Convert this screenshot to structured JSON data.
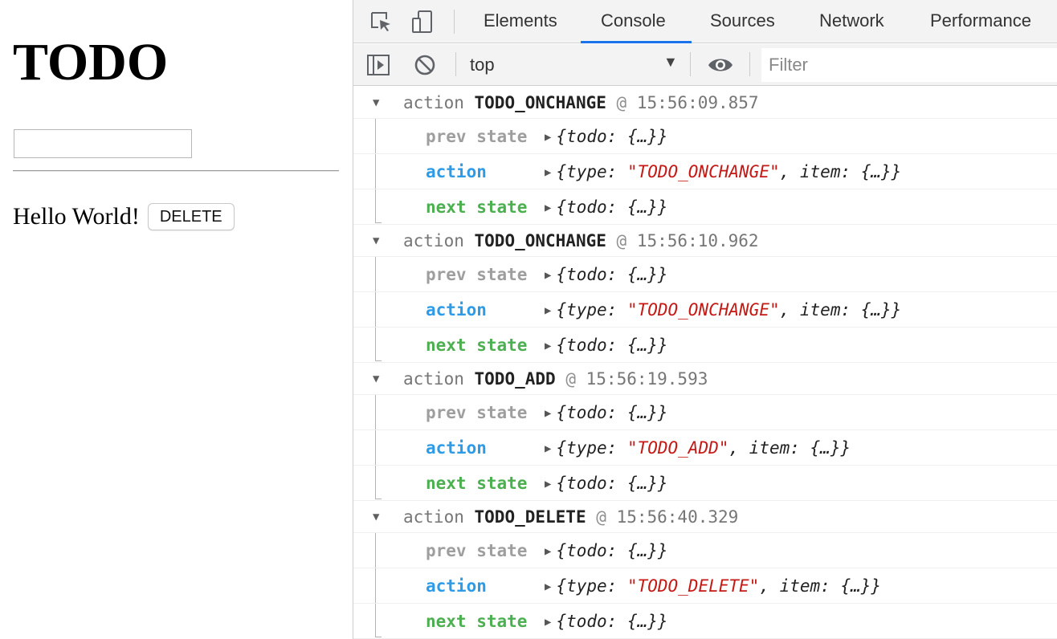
{
  "app": {
    "title": "TODO",
    "input_value": "",
    "items": [
      {
        "text": "Hello World!",
        "delete_label": "DELETE"
      }
    ]
  },
  "devtools": {
    "icons": [
      "inspect-element-icon",
      "device-toolbar-icon"
    ],
    "tabs": [
      {
        "label": "Elements",
        "active": false
      },
      {
        "label": "Console",
        "active": true
      },
      {
        "label": "Sources",
        "active": false
      },
      {
        "label": "Network",
        "active": false
      },
      {
        "label": "Performance",
        "active": false
      }
    ],
    "toolbar": {
      "context": "top",
      "filter_placeholder": "Filter",
      "icons": [
        "sidebar-toggle-icon",
        "clear-console-icon",
        "live-expression-eye-icon"
      ]
    },
    "colors": {
      "accent": "#1a73e8",
      "prev_state": "#9e9e9e",
      "action": "#2e9be6",
      "next_state": "#4caf50",
      "string": "#c41a16"
    },
    "groups": [
      {
        "prefix": "action",
        "type": "TODO_ONCHANGE",
        "at": "@",
        "time": "15:56:09.857",
        "rows": [
          {
            "label": "prev state",
            "kind": "prev",
            "obj_open": "{todo: ",
            "obj_mid": "{…}",
            "obj_close": "}"
          },
          {
            "label": "action",
            "kind": "action",
            "type_key": "{type: ",
            "type_value": "\"TODO_ONCHANGE\"",
            "rest": ", item: {…}}"
          },
          {
            "label": "next state",
            "kind": "next",
            "obj_open": "{todo: ",
            "obj_mid": "{…}",
            "obj_close": "}"
          }
        ]
      },
      {
        "prefix": "action",
        "type": "TODO_ONCHANGE",
        "at": "@",
        "time": "15:56:10.962",
        "rows": [
          {
            "label": "prev state",
            "kind": "prev",
            "obj_open": "{todo: ",
            "obj_mid": "{…}",
            "obj_close": "}"
          },
          {
            "label": "action",
            "kind": "action",
            "type_key": "{type: ",
            "type_value": "\"TODO_ONCHANGE\"",
            "rest": ", item: {…}}"
          },
          {
            "label": "next state",
            "kind": "next",
            "obj_open": "{todo: ",
            "obj_mid": "{…}",
            "obj_close": "}"
          }
        ]
      },
      {
        "prefix": "action",
        "type": "TODO_ADD",
        "at": "@",
        "time": "15:56:19.593",
        "rows": [
          {
            "label": "prev state",
            "kind": "prev",
            "obj_open": "{todo: ",
            "obj_mid": "{…}",
            "obj_close": "}"
          },
          {
            "label": "action",
            "kind": "action",
            "type_key": "{type: ",
            "type_value": "\"TODO_ADD\"",
            "rest": ", item: {…}}"
          },
          {
            "label": "next state",
            "kind": "next",
            "obj_open": "{todo: ",
            "obj_mid": "{…}",
            "obj_close": "}"
          }
        ]
      },
      {
        "prefix": "action",
        "type": "TODO_DELETE",
        "at": "@",
        "time": "15:56:40.329",
        "rows": [
          {
            "label": "prev state",
            "kind": "prev",
            "obj_open": "{todo: ",
            "obj_mid": "{…}",
            "obj_close": "}"
          },
          {
            "label": "action",
            "kind": "action",
            "type_key": "{type: ",
            "type_value": "\"TODO_DELETE\"",
            "rest": ", item: {…}}"
          },
          {
            "label": "next state",
            "kind": "next",
            "obj_open": "{todo: ",
            "obj_mid": "{…}",
            "obj_close": "}"
          }
        ]
      }
    ]
  }
}
